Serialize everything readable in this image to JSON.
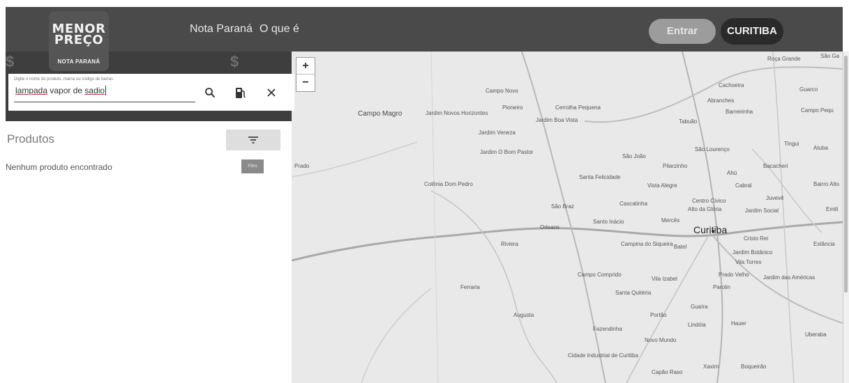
{
  "header": {
    "logo": {
      "line1": "MENOR",
      "line2": "PREÇO",
      "line3": "NOTA PARANÁ"
    },
    "nav": [
      "Nota Paraná",
      "O que é"
    ],
    "login_label": "Entrar",
    "city_label": "CURITIBA"
  },
  "search": {
    "label": "Digite o nome do produto, marca ou código de barras",
    "value_part1": "lampada",
    "value_part2": " vapor de ",
    "value_part3": "sadio",
    "icons": [
      "search-icon",
      "fuel-pump-icon",
      "close-icon"
    ]
  },
  "results": {
    "title": "Produtos",
    "empty_message": "Nenhum produto encontrado",
    "filter_small_label": "Filtro"
  },
  "map": {
    "zoom_in": "+",
    "zoom_out": "−",
    "places": [
      "Roça Grande",
      "São Ga",
      "Cachoeira",
      "Guarco",
      "Campo Novo",
      "Abranches",
      "Barreirinha",
      "Campo Pequ",
      "Campo Magro",
      "Jardim Novos Horizontes",
      "Pioneiro",
      "Cerrolha Pequena",
      "Jardim Boa Vista",
      "Tabuão",
      "Jardim Veneza",
      "São Lourenço",
      "Tingui",
      "Atuba",
      "Jardim O Bom Pastor",
      "São João",
      "Pilarzinho",
      "Bacacheri",
      "Ahú",
      "Prado",
      "Santa Felicidade",
      "Vista Alegre",
      "Cabral",
      "Bairro Alto",
      "Colônia Dom Pedro",
      "Juvevê",
      "São Braz",
      "Cascatinha",
      "Centro Cívico",
      "Alto da Glória",
      "Jardim Social",
      "Emili",
      "Santo Inácio",
      "Mercês",
      "Orleans",
      "Curitiba",
      "Cristo Rei",
      "Riviera",
      "Campina do Siqueira",
      "Batel",
      "Jardim Botânico",
      "Estância",
      "Vila Torres",
      "Campo Comprido",
      "Vila Izabel",
      "Prado Velho",
      "Jardim das Américas",
      "Ferraria",
      "Parolin",
      "Santa Quitéria",
      "Guaíra",
      "Augusta",
      "Portão",
      "Lindóia",
      "Hauer",
      "Fazendinha",
      "Uberaba",
      "Novo Mundo",
      "Cidade Industrial de Curitiba",
      "Capão Raso",
      "Xaxim",
      "Boqueirão"
    ]
  },
  "colors": {
    "topbar": "#4a4a4a",
    "city_button": "#2a2a2a",
    "login_button": "#9c9c9c",
    "map_bg": "#e9e9e9"
  }
}
